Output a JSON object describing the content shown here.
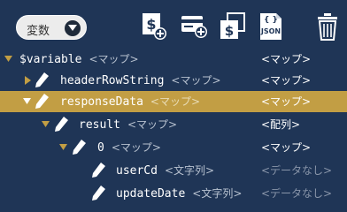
{
  "toolbar": {
    "scope_label": "変数",
    "icons": [
      "add-variable-icon",
      "add-card-icon",
      "copy-value-icon",
      "json-icon",
      "trash-icon"
    ],
    "json_icon_text": "JSON",
    "json_icon_braces": "{ }"
  },
  "tree": [
    {
      "key": "$variable",
      "type": "<マップ>",
      "value": "<マップ>",
      "expanded": true,
      "selected": false
    },
    {
      "key": "headerRowString",
      "type": "<マップ>",
      "value": "<マップ>",
      "expanded": false,
      "selected": false
    },
    {
      "key": "responseData",
      "type": "<マップ>",
      "value": "<マップ>",
      "expanded": true,
      "selected": true
    },
    {
      "key": "result",
      "type": "<マップ>",
      "value": "<配列>",
      "expanded": true,
      "selected": false
    },
    {
      "key": "0",
      "type": "<マップ>",
      "value": "<マップ>",
      "expanded": true,
      "selected": false
    },
    {
      "key": "userCd",
      "type": "<文字列>",
      "value": "<データなし>",
      "selected": false
    },
    {
      "key": "updateDate",
      "type": "<文字列>",
      "value": "<データなし>",
      "selected": false
    }
  ],
  "colors": {
    "background": "#1f3556",
    "selected_row": "#c29e44",
    "no_data_text": "#8a96aa"
  }
}
